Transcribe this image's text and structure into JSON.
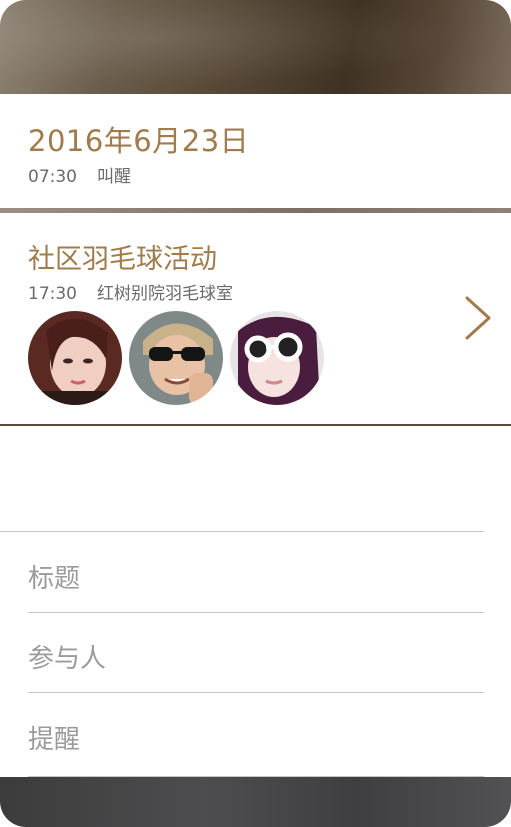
{
  "wakeup_card": {
    "date": "2016年6月23日",
    "time": "07:30",
    "label": "叫醒"
  },
  "event_card": {
    "title": "社区羽毛球活动",
    "time": "17:30",
    "location": "红树别院羽毛球室",
    "participants": [
      {
        "name": "avatar-participant-1"
      },
      {
        "name": "avatar-participant-2"
      },
      {
        "name": "avatar-participant-3"
      }
    ],
    "more_icon": "chevron-right-icon"
  },
  "form": {
    "title_placeholder": "标题",
    "participants_placeholder": "参与人",
    "reminder_placeholder": "提醒"
  },
  "colors": {
    "accent": "#a07b4b",
    "text_secondary": "#6a6a6a",
    "placeholder": "#9b9b9b",
    "divider": "#c6c6c6"
  }
}
